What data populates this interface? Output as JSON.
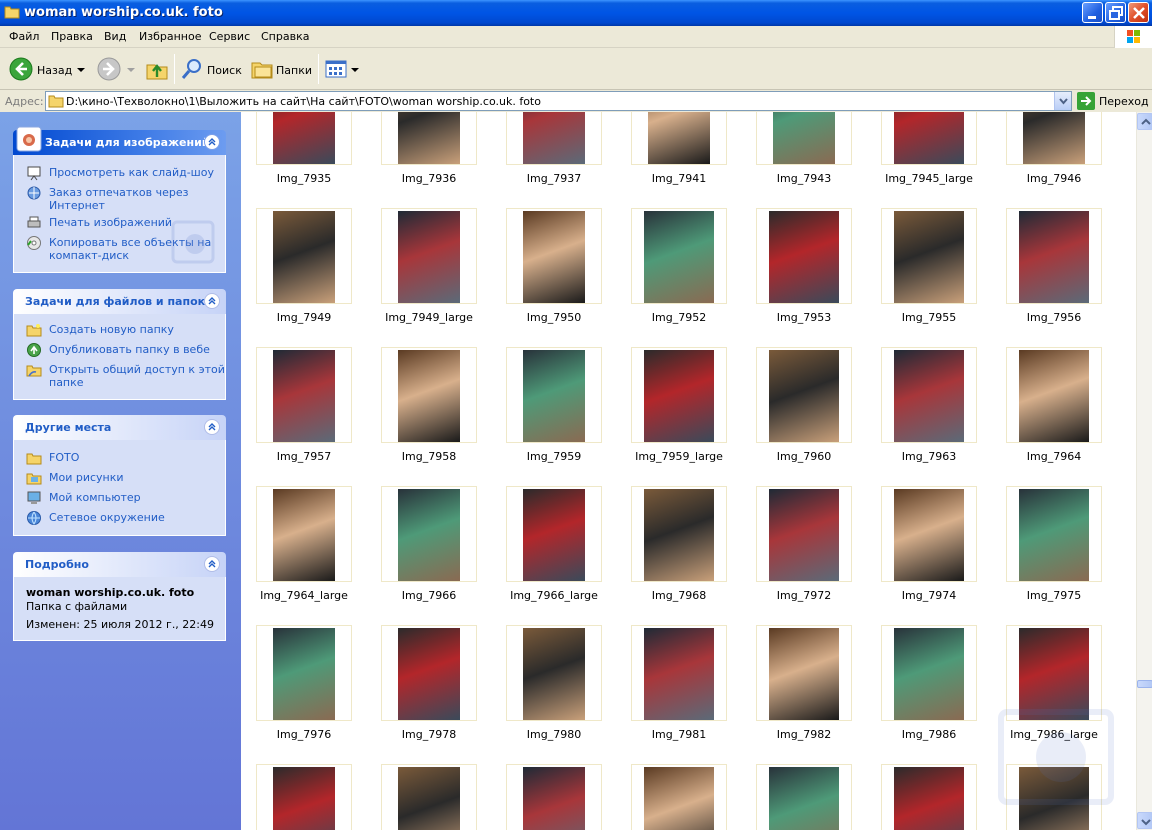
{
  "window": {
    "title": "woman worship.co.uk. foto",
    "minimize_icon": "minimize-icon",
    "maximize_icon": "maximize-icon",
    "close_icon": "close-icon"
  },
  "menu": [
    "Файл",
    "Правка",
    "Вид",
    "Избранное",
    "Сервис",
    "Справка"
  ],
  "toolbar": {
    "back_label": "Назад",
    "search_label": "Поиск",
    "folders_label": "Папки"
  },
  "address": {
    "label": "Адрес:",
    "path": "D:\\кино-\\Техволокно\\1\\Выложить на сайт\\На сайт\\FOTO\\woman worship.co.uk. foto",
    "go_label": "Переход"
  },
  "left_pane": {
    "image_tasks": {
      "title": "Задачи для изображений",
      "items": [
        {
          "label": "Просмотреть как слайд-шоу",
          "icon": "slideshow-icon"
        },
        {
          "label": "Заказ отпечатков через\nИнтернет",
          "icon": "order-prints-icon"
        },
        {
          "label": "Печать изображений",
          "icon": "print-icon"
        },
        {
          "label": "Копировать все объекты на\nкомпакт-диск",
          "icon": "cd-copy-icon"
        }
      ]
    },
    "file_tasks": {
      "title": "Задачи для файлов и папок",
      "items": [
        {
          "label": "Создать новую папку",
          "icon": "new-folder-icon"
        },
        {
          "label": "Опубликовать папку в вебе",
          "icon": "publish-web-icon"
        },
        {
          "label": "Открыть общий доступ к этой\nпапке",
          "icon": "share-folder-icon"
        }
      ]
    },
    "other_places": {
      "title": "Другие места",
      "items": [
        {
          "label": "FOTO",
          "icon": "folder-icon"
        },
        {
          "label": "Мои рисунки",
          "icon": "my-pictures-icon"
        },
        {
          "label": "Мой компьютер",
          "icon": "my-computer-icon"
        },
        {
          "label": "Сетевое окружение",
          "icon": "network-icon"
        }
      ]
    },
    "details": {
      "title": "Подробно",
      "name": "woman worship.co.uk. foto",
      "type": "Папка с файлами",
      "modified": "Изменен: 25 июля 2012 г., 22:49"
    }
  },
  "files": [
    [
      "Img_7935",
      "Img_7936",
      "Img_7937",
      "Img_7941",
      "Img_7943",
      "Img_7945_large",
      "Img_7946"
    ],
    [
      "Img_7949",
      "Img_7949_large",
      "Img_7950",
      "Img_7952",
      "Img_7953",
      "Img_7955",
      "Img_7956"
    ],
    [
      "Img_7957",
      "Img_7958",
      "Img_7959",
      "Img_7959_large",
      "Img_7960",
      "Img_7963",
      "Img_7964"
    ],
    [
      "Img_7964_large",
      "Img_7966",
      "Img_7966_large",
      "Img_7968",
      "Img_7972",
      "Img_7974",
      "Img_7975"
    ],
    [
      "Img_7976",
      "Img_7978",
      "Img_7980",
      "Img_7981",
      "Img_7982",
      "Img_7986",
      "Img_7986_large"
    ]
  ],
  "colors": {
    "titlebar": "#0055e5",
    "task_pane": "#6375d6",
    "link": "#215dc6"
  }
}
